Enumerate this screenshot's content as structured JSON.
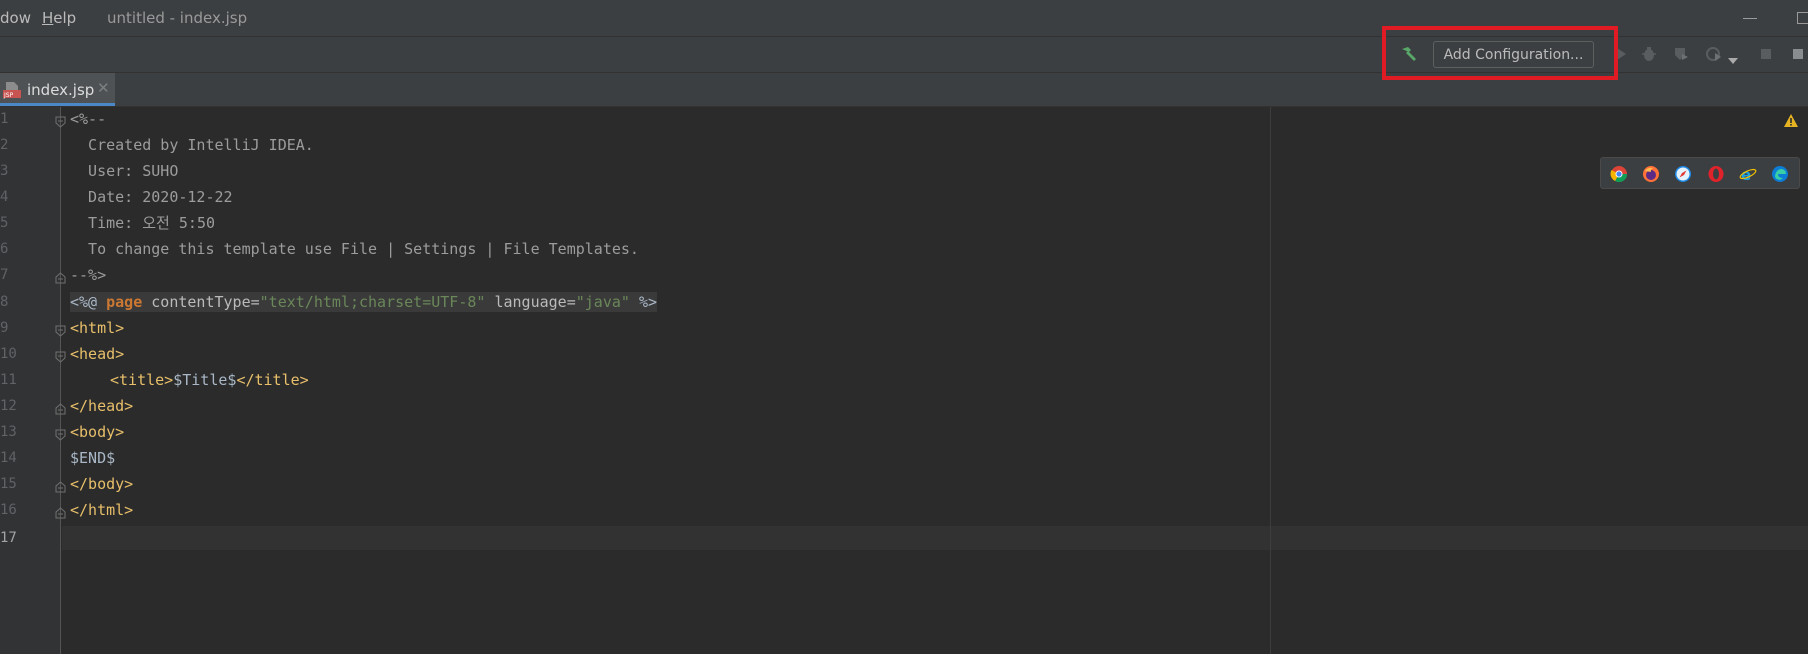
{
  "window": {
    "menu": [
      {
        "label": "dow"
      },
      {
        "label": "Help"
      }
    ],
    "title": "untitled - index.jsp"
  },
  "toolbar": {
    "add_configuration_label": "Add Configuration...",
    "icons": [
      "hammer-icon",
      "run-icon",
      "debug-icon",
      "coverage-icon",
      "profile-icon",
      "stop-icon"
    ],
    "highlight_color": "#e01b24"
  },
  "tabs": [
    {
      "label": "index.jsp",
      "icon": "jsp-file-icon",
      "active": true,
      "close": "✕"
    }
  ],
  "editor": {
    "line_numbers": [
      "1",
      "2",
      "3",
      "4",
      "5",
      "6",
      "7",
      "8",
      "9",
      "10",
      "11",
      "12",
      "13",
      "14",
      "15",
      "16",
      "17"
    ],
    "current_line": "17",
    "lines": {
      "l1": "<%--",
      "l2": "  Created by IntelliJ IDEA.",
      "l3": "  User: SUHO",
      "l4": "  Date: 2020-12-22",
      "l5": "  Time: 오전 5:50",
      "l6": "  To change this template use File | Settings | File Templates.",
      "l7": "--%>",
      "l8": {
        "open": "<%@ ",
        "kw": "page",
        "attr1": " contentType=",
        "val1": "\"text/html;charset=UTF-8\"",
        "attr2": " language=",
        "val2": "\"java\"",
        "close": " %>"
      },
      "l9": "<html>",
      "l10": "<head>",
      "l11": {
        "open": "<title>",
        "text": "$Title$",
        "close": "</title>"
      },
      "l12": "</head>",
      "l13": "<body>",
      "l14": "$END$",
      "l15": "</body>",
      "l16": "</html>"
    },
    "browsers": [
      "chrome-icon",
      "firefox-icon",
      "safari-icon",
      "opera-icon",
      "internet-explorer-icon",
      "edge-icon"
    ],
    "warning_icon": "warning-icon"
  }
}
